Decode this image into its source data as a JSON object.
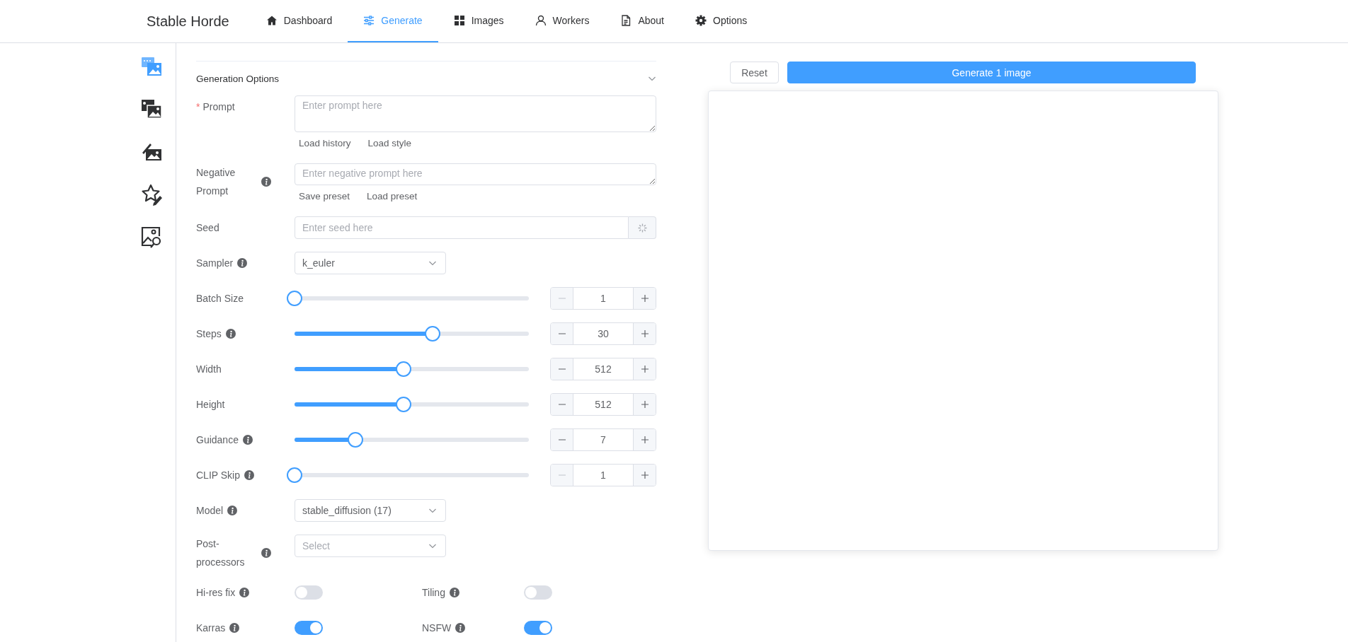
{
  "app": {
    "title": "Stable Horde"
  },
  "nav": [
    {
      "label": "Dashboard",
      "selected": false
    },
    {
      "label": "Generate",
      "selected": true
    },
    {
      "label": "Images",
      "selected": false
    },
    {
      "label": "Workers",
      "selected": false
    },
    {
      "label": "About",
      "selected": false
    },
    {
      "label": "Options",
      "selected": false
    }
  ],
  "sidebar": [
    {
      "selected": true
    },
    {
      "selected": false
    },
    {
      "selected": false
    },
    {
      "selected": false
    },
    {
      "selected": false
    }
  ],
  "section": {
    "title": "Generation Options",
    "expanded": true
  },
  "fields": [
    {
      "kind": "textarea",
      "label": "Prompt",
      "marker": "*",
      "info": false,
      "placeholder": "Enter prompt here",
      "links": [
        "Load history",
        "Load style"
      ]
    },
    {
      "kind": "textarea",
      "label": "Negative Prompt",
      "info": true,
      "placeholder": "Enter negative prompt here",
      "links": [
        "Save preset",
        "Load preset"
      ]
    },
    {
      "kind": "seed",
      "label": "Seed",
      "info": false,
      "placeholder": "Enter seed here"
    },
    {
      "kind": "select",
      "label": "Sampler",
      "info": true,
      "value": "k_euler"
    },
    {
      "kind": "slider",
      "label": "Batch Size",
      "info": false,
      "level": 0,
      "value": "1",
      "min_disabled": true
    },
    {
      "kind": "slider",
      "label": "Steps",
      "info": true,
      "level": 0.59,
      "value": "30",
      "min_disabled": false
    },
    {
      "kind": "slider",
      "label": "Width",
      "info": false,
      "level": 0.465,
      "value": "512",
      "min_disabled": false
    },
    {
      "kind": "slider",
      "label": "Height",
      "info": false,
      "level": 0.465,
      "value": "512",
      "min_disabled": false
    },
    {
      "kind": "slider",
      "label": "Guidance",
      "info": true,
      "level": 0.26,
      "value": "7",
      "min_disabled": false
    },
    {
      "kind": "slider",
      "label": "CLIP Skip",
      "info": true,
      "level": 0,
      "value": "1",
      "min_disabled": true
    },
    {
      "kind": "select",
      "label": "Model",
      "info": true,
      "value": "stable_diffusion (17)"
    },
    {
      "kind": "select",
      "label": "Post-processors",
      "info": true,
      "placeholder": "Select"
    }
  ],
  "toggles": [
    {
      "label": "Hi-res fix",
      "info": true,
      "on": false
    },
    {
      "label": "Tiling",
      "info": true,
      "on": false
    },
    {
      "label": "Karras",
      "info": true,
      "on": true
    },
    {
      "label": "NSFW",
      "info": true,
      "on": true
    }
  ],
  "actions": {
    "reset": "Reset",
    "generate": "Generate 1 image"
  }
}
